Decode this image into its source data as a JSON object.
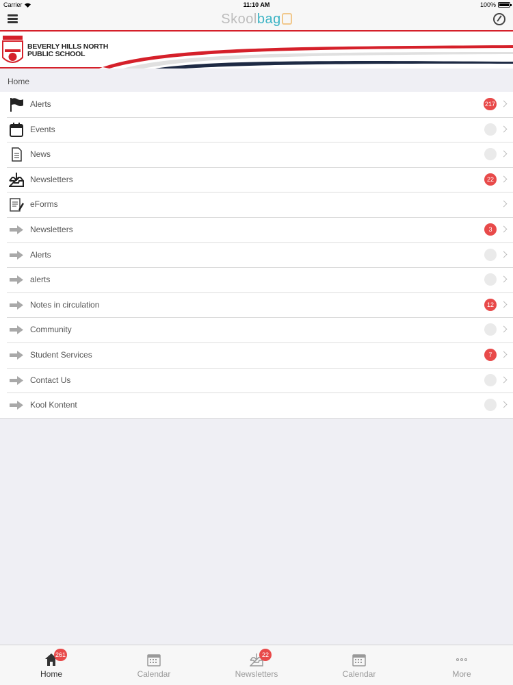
{
  "status_bar": {
    "carrier": "Carrier",
    "time": "11:10 AM",
    "battery": "100%"
  },
  "nav": {
    "logo_skool": "Skool",
    "logo_bag": "bag"
  },
  "banner": {
    "school_line1": "BEVERLY HILLS NORTH",
    "school_line2": "PUBLIC SCHOOL"
  },
  "breadcrumb": "Home",
  "menu": [
    {
      "label": "Alerts",
      "icon": "flag-icon",
      "badge": "217"
    },
    {
      "label": "Events",
      "icon": "calendar-icon",
      "badge": ""
    },
    {
      "label": "News",
      "icon": "document-icon",
      "badge": ""
    },
    {
      "label": "Newsletters",
      "icon": "inbox-download-icon",
      "badge": "22"
    },
    {
      "label": "eForms",
      "icon": "form-icon",
      "badge": null
    },
    {
      "label": "Newsletters",
      "icon": "arrow-right-icon",
      "badge": "3"
    },
    {
      "label": "Alerts",
      "icon": "arrow-right-icon",
      "badge": ""
    },
    {
      "label": "alerts",
      "icon": "arrow-right-icon",
      "badge": ""
    },
    {
      "label": "Notes in circulation",
      "icon": "arrow-right-icon",
      "badge": "12"
    },
    {
      "label": "Community",
      "icon": "arrow-right-icon",
      "badge": ""
    },
    {
      "label": "Student Services",
      "icon": "arrow-right-icon",
      "badge": "7"
    },
    {
      "label": "Contact Us",
      "icon": "arrow-right-icon",
      "badge": ""
    },
    {
      "label": "Kool Kontent",
      "icon": "arrow-right-icon",
      "badge": ""
    }
  ],
  "tabs": [
    {
      "label": "Home",
      "icon": "home-icon",
      "badge": "261",
      "active": true
    },
    {
      "label": "Calendar",
      "icon": "calendar-icon",
      "badge": null,
      "active": false
    },
    {
      "label": "Newsletters",
      "icon": "inbox-download-icon",
      "badge": "22",
      "active": false
    },
    {
      "label": "Calendar",
      "icon": "calendar-icon",
      "badge": null,
      "active": false
    },
    {
      "label": "More",
      "icon": "more-dots-icon",
      "badge": null,
      "active": false
    }
  ],
  "colors": {
    "accent_red": "#d5202a",
    "badge_red": "#e84a4a",
    "logo_teal": "#3bb3c4"
  }
}
